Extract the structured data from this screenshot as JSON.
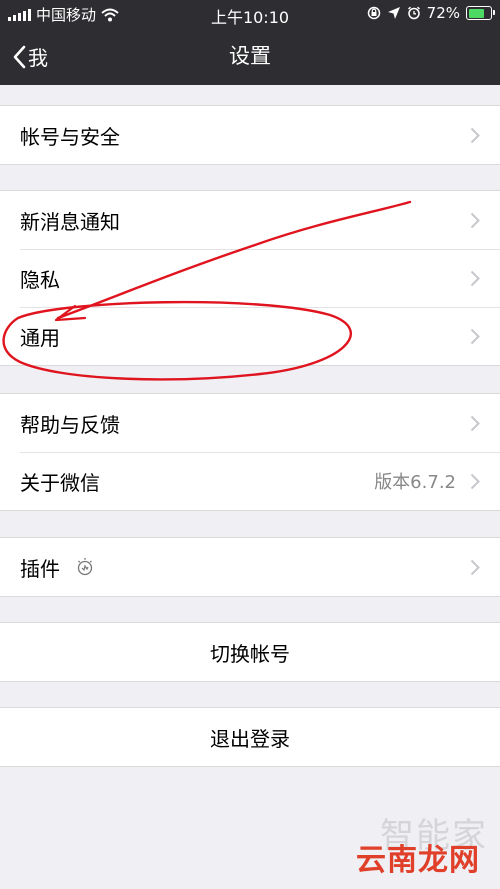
{
  "status_bar": {
    "carrier": "中国移动",
    "time": "上午10:10",
    "battery": "72%",
    "battery_level": 0.72
  },
  "nav": {
    "back_label": "我",
    "title": "设置"
  },
  "groups": [
    {
      "items": [
        {
          "label": "帐号与安全"
        }
      ]
    },
    {
      "items": [
        {
          "label": "新消息通知"
        },
        {
          "label": "隐私"
        },
        {
          "label": "通用"
        }
      ]
    },
    {
      "items": [
        {
          "label": "帮助与反馈"
        },
        {
          "label": "关于微信",
          "value": "版本6.7.2"
        }
      ]
    },
    {
      "items": [
        {
          "label": "插件"
        }
      ]
    },
    {
      "items": [
        {
          "label": "切换帐号"
        }
      ]
    },
    {
      "items": [
        {
          "label": "退出登录"
        }
      ]
    }
  ],
  "watermark": {
    "faint": "智能家",
    "main": "云南龙网"
  },
  "colors": {
    "nav_bg": "#2e2e32",
    "page_bg": "#efeff4",
    "annotation": "#e0141e",
    "battery_fill": "#4cd964"
  }
}
